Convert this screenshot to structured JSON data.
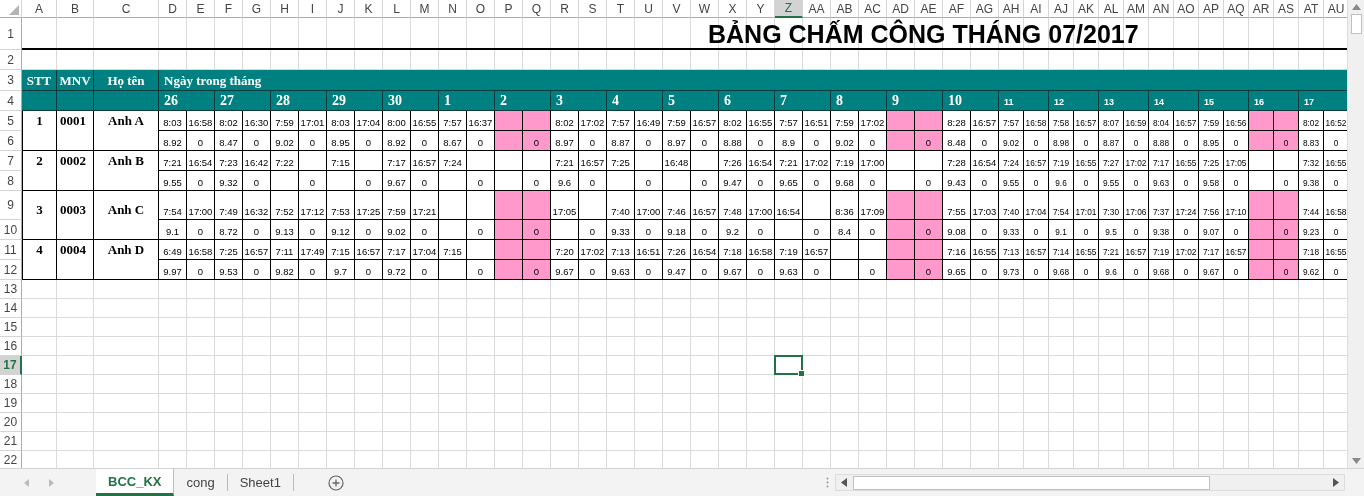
{
  "columns": [
    {
      "label": "A",
      "selected": false
    },
    {
      "label": "B",
      "selected": false
    },
    {
      "label": "C",
      "selected": false
    },
    {
      "label": "D",
      "selected": false
    },
    {
      "label": "E",
      "selected": false
    },
    {
      "label": "F",
      "selected": false
    },
    {
      "label": "G",
      "selected": false
    },
    {
      "label": "H",
      "selected": false
    },
    {
      "label": "I",
      "selected": false
    },
    {
      "label": "J",
      "selected": false
    },
    {
      "label": "K",
      "selected": false
    },
    {
      "label": "L",
      "selected": false
    },
    {
      "label": "M",
      "selected": false
    },
    {
      "label": "N",
      "selected": false
    },
    {
      "label": "O",
      "selected": false
    },
    {
      "label": "P",
      "selected": false
    },
    {
      "label": "Q",
      "selected": false
    },
    {
      "label": "R",
      "selected": false
    },
    {
      "label": "S",
      "selected": false
    },
    {
      "label": "T",
      "selected": false
    },
    {
      "label": "U",
      "selected": false
    },
    {
      "label": "V",
      "selected": false
    },
    {
      "label": "W",
      "selected": false
    },
    {
      "label": "X",
      "selected": false
    },
    {
      "label": "Y",
      "selected": false
    },
    {
      "label": "Z",
      "selected": true
    },
    {
      "label": "AA",
      "selected": false
    },
    {
      "label": "AB",
      "selected": false
    },
    {
      "label": "AC",
      "selected": false
    },
    {
      "label": "AD",
      "selected": false
    },
    {
      "label": "AE",
      "selected": false
    },
    {
      "label": "AF",
      "selected": false
    },
    {
      "label": "AG",
      "selected": false
    },
    {
      "label": "AH",
      "selected": false
    },
    {
      "label": "AI",
      "selected": false
    },
    {
      "label": "AJ",
      "selected": false
    },
    {
      "label": "AK",
      "selected": false
    },
    {
      "label": "AL",
      "selected": false
    },
    {
      "label": "AM",
      "selected": false
    },
    {
      "label": "AN",
      "selected": false
    },
    {
      "label": "AO",
      "selected": false
    },
    {
      "label": "AP",
      "selected": false
    },
    {
      "label": "AQ",
      "selected": false
    },
    {
      "label": "AR",
      "selected": false
    },
    {
      "label": "AS",
      "selected": false
    },
    {
      "label": "AT",
      "selected": false
    },
    {
      "label": "AU",
      "selected": false
    }
  ],
  "rows": [
    {
      "label": "1",
      "selected": false
    },
    {
      "label": "2",
      "selected": false
    },
    {
      "label": "3",
      "selected": false
    },
    {
      "label": "4",
      "selected": false
    },
    {
      "label": "5",
      "selected": false
    },
    {
      "label": "6",
      "selected": false
    },
    {
      "label": "7",
      "selected": false
    },
    {
      "label": "8",
      "selected": false
    },
    {
      "label": "9",
      "selected": false
    },
    {
      "label": "10",
      "selected": false
    },
    {
      "label": "11",
      "selected": false
    },
    {
      "label": "12",
      "selected": false
    },
    {
      "label": "13",
      "selected": false
    },
    {
      "label": "14",
      "selected": false
    },
    {
      "label": "15",
      "selected": false
    },
    {
      "label": "16",
      "selected": false
    },
    {
      "label": "17",
      "selected": true
    },
    {
      "label": "18",
      "selected": false
    },
    {
      "label": "19",
      "selected": false
    },
    {
      "label": "20",
      "selected": false
    },
    {
      "label": "21",
      "selected": false
    },
    {
      "label": "22",
      "selected": false
    }
  ],
  "title": "BẢNG CHẤM CÔNG THÁNG 07/2017",
  "headers": {
    "stt": "STT",
    "mnv": "MNV",
    "name": "Họ tên",
    "days": "Ngày trong tháng"
  },
  "days": [
    {
      "label": "26",
      "kind": "large"
    },
    {
      "label": "27",
      "kind": "large"
    },
    {
      "label": "28",
      "kind": "large"
    },
    {
      "label": "29",
      "kind": "large"
    },
    {
      "label": "30",
      "kind": "large"
    },
    {
      "label": "1",
      "kind": "large"
    },
    {
      "label": "2",
      "kind": "large"
    },
    {
      "label": "3",
      "kind": "large"
    },
    {
      "label": "4",
      "kind": "large"
    },
    {
      "label": "5",
      "kind": "large"
    },
    {
      "label": "6",
      "kind": "large"
    },
    {
      "label": "7",
      "kind": "large"
    },
    {
      "label": "8",
      "kind": "large"
    },
    {
      "label": "9",
      "kind": "large"
    },
    {
      "label": "10",
      "kind": "large"
    },
    {
      "label": "11",
      "kind": "small"
    },
    {
      "label": "12",
      "kind": "small"
    },
    {
      "label": "13",
      "kind": "small"
    },
    {
      "label": "14",
      "kind": "small"
    },
    {
      "label": "15",
      "kind": "small"
    },
    {
      "label": "16",
      "kind": "small"
    },
    {
      "label": "17",
      "kind": "small"
    }
  ],
  "employees": [
    {
      "stt": "1",
      "mnv": "0001",
      "name": "Anh A",
      "days": [
        {
          "in": "8:03",
          "out": "16:58",
          "hours": "8.92",
          "ot": "0",
          "off": false
        },
        {
          "in": "8:02",
          "out": "16:30",
          "hours": "8.47",
          "ot": "0",
          "off": false
        },
        {
          "in": "7:59",
          "out": "17:01",
          "hours": "9.02",
          "ot": "0",
          "off": false
        },
        {
          "in": "8:03",
          "out": "17:04",
          "hours": "8.95",
          "ot": "0",
          "off": false
        },
        {
          "in": "8:00",
          "out": "16:55",
          "hours": "8.92",
          "ot": "0",
          "off": false
        },
        {
          "in": "7:57",
          "out": "16:37",
          "hours": "8.67",
          "ot": "0",
          "off": false
        },
        {
          "ot": "0",
          "off": true
        },
        {
          "in": "8:02",
          "out": "17:02",
          "hours": "8.97",
          "ot": "0",
          "off": false
        },
        {
          "in": "7:57",
          "out": "16:49",
          "hours": "8.87",
          "ot": "0",
          "off": false
        },
        {
          "in": "7:59",
          "out": "16:57",
          "hours": "8.97",
          "ot": "0",
          "off": false
        },
        {
          "in": "8:02",
          "out": "16:55",
          "hours": "8.88",
          "ot": "0",
          "off": false
        },
        {
          "in": "7:57",
          "out": "16:51",
          "hours": "8.9",
          "ot": "0",
          "off": false
        },
        {
          "in": "7:59",
          "out": "17:02",
          "hours": "9.02",
          "ot": "0",
          "off": false
        },
        {
          "ot": "0",
          "off": true
        },
        {
          "in": "8:28",
          "out": "16:57",
          "hours": "8.48",
          "ot": "0",
          "off": false
        },
        {
          "in": "7:57",
          "out": "16:58",
          "hours": "9.02",
          "ot": "0",
          "off": false
        },
        {
          "in": "7:58",
          "out": "16:57",
          "hours": "8.98",
          "ot": "0",
          "off": false
        },
        {
          "in": "8:07",
          "out": "16:59",
          "hours": "8.87",
          "ot": "0",
          "off": false
        },
        {
          "in": "8:04",
          "out": "16:57",
          "hours": "8.88",
          "ot": "0",
          "off": false
        },
        {
          "in": "7:59",
          "out": "16:56",
          "hours": "8.95",
          "ot": "0",
          "off": false
        },
        {
          "ot": "0",
          "off": true
        },
        {
          "in": "8:02",
          "out": "16:52",
          "hours": "8.83",
          "ot": "0",
          "off": false
        }
      ]
    },
    {
      "stt": "2",
      "mnv": "0002",
      "name": "Anh B",
      "days": [
        {
          "in": "7:21",
          "out": "16:54",
          "hours": "9.55",
          "ot": "0",
          "off": false
        },
        {
          "in": "7:23",
          "out": "16:42",
          "hours": "9.32",
          "ot": "0",
          "off": false
        },
        {
          "in": "7:22",
          "ot": "0",
          "off": false
        },
        {
          "in": "7:15",
          "ot": "0",
          "off": false
        },
        {
          "in": "7:17",
          "out": "16:57",
          "hours": "9.67",
          "ot": "0",
          "off": false
        },
        {
          "in": "7:24",
          "ot": "0",
          "off": false
        },
        {
          "ot": "0",
          "off": false
        },
        {
          "in": "7:21",
          "out": "16:57",
          "hours": "9.6",
          "ot": "0",
          "off": false
        },
        {
          "in": "7:25",
          "ot": "0",
          "off": false
        },
        {
          "in": "16:48",
          "ot": "0",
          "off": false
        },
        {
          "in": "7:26",
          "out": "16:54",
          "hours": "9.47",
          "ot": "0",
          "off": false
        },
        {
          "in": "7:21",
          "out": "17:02",
          "hours": "9.65",
          "ot": "0",
          "off": false
        },
        {
          "in": "7:19",
          "out": "17:00",
          "hours": "9.68",
          "ot": "0",
          "off": false
        },
        {
          "ot": "0",
          "off": false
        },
        {
          "in": "7:28",
          "out": "16:54",
          "hours": "9.43",
          "ot": "0",
          "off": false
        },
        {
          "in": "7:24",
          "out": "16:57",
          "hours": "9.55",
          "ot": "0",
          "off": false
        },
        {
          "in": "7:19",
          "out": "16:55",
          "hours": "9.6",
          "ot": "0",
          "off": false
        },
        {
          "in": "7:27",
          "out": "17:02",
          "hours": "9.55",
          "ot": "0",
          "off": false
        },
        {
          "in": "7:17",
          "out": "16:55",
          "hours": "9.63",
          "ot": "0",
          "off": false
        },
        {
          "in": "7:25",
          "out": "17:05",
          "hours": "9.58",
          "ot": "0",
          "off": false
        },
        {
          "ot": "0",
          "off": false
        },
        {
          "in": "7:32",
          "out": "16:55",
          "hours": "9.38",
          "ot": "0",
          "off": false
        }
      ]
    },
    {
      "stt": "3",
      "mnv": "0003",
      "name": "Anh C",
      "days": [
        {
          "in": "7:54",
          "out": "17:00",
          "hours": "9.1",
          "ot": "0",
          "off": false
        },
        {
          "in": "7:49",
          "out": "16:32",
          "hours": "8.72",
          "ot": "0",
          "off": false
        },
        {
          "in": "7:52",
          "out": "17:12",
          "hours": "9.13",
          "ot": "0",
          "off": false
        },
        {
          "in": "7:53",
          "out": "17:25",
          "hours": "9.12",
          "ot": "0",
          "off": false
        },
        {
          "in": "7:59",
          "out": "17:21",
          "hours": "9.02",
          "ot": "0",
          "off": false
        },
        {
          "ot": "0",
          "off": false
        },
        {
          "ot": "0",
          "off": true
        },
        {
          "in": "17:05",
          "ot": "0",
          "off": false
        },
        {
          "in": "7:40",
          "out": "17:00",
          "hours": "9.33",
          "ot": "0",
          "off": false
        },
        {
          "in": "7:46",
          "out": "16:57",
          "hours": "9.18",
          "ot": "0",
          "off": false
        },
        {
          "in": "7:48",
          "out": "17:00",
          "hours": "9.2",
          "ot": "0",
          "off": false
        },
        {
          "in": "16:54",
          "ot": "0",
          "off": false
        },
        {
          "in": "8:36",
          "out": "17:09",
          "hours": "8.4",
          "ot": "0",
          "off": false
        },
        {
          "ot": "0",
          "off": true
        },
        {
          "in": "7:55",
          "out": "17:03",
          "hours": "9.08",
          "ot": "0",
          "off": false
        },
        {
          "in": "7:40",
          "out": "17:04",
          "hours": "9.33",
          "ot": "0",
          "off": false
        },
        {
          "in": "7:54",
          "out": "17:01",
          "hours": "9.1",
          "ot": "0",
          "off": false
        },
        {
          "in": "7:30",
          "out": "17:06",
          "hours": "9.5",
          "ot": "0",
          "off": false
        },
        {
          "in": "7:37",
          "out": "17:24",
          "hours": "9.38",
          "ot": "0",
          "off": false
        },
        {
          "in": "7:56",
          "out": "17:10",
          "hours": "9.07",
          "ot": "0",
          "off": false
        },
        {
          "ot": "0",
          "off": true
        },
        {
          "in": "7:44",
          "out": "16:58",
          "hours": "9.23",
          "ot": "0",
          "off": false
        }
      ]
    },
    {
      "stt": "4",
      "mnv": "0004",
      "name": "Anh D",
      "days": [
        {
          "in": "6:49",
          "out": "16:58",
          "hours": "9.97",
          "ot": "0",
          "off": false
        },
        {
          "in": "7:25",
          "out": "16:57",
          "hours": "9.53",
          "ot": "0",
          "off": false
        },
        {
          "in": "7:11",
          "out": "17:49",
          "hours": "9.82",
          "ot": "0",
          "off": false
        },
        {
          "in": "7:15",
          "out": "16:57",
          "hours": "9.7",
          "ot": "0",
          "off": false
        },
        {
          "in": "7:17",
          "out": "17:04",
          "hours": "9.72",
          "ot": "0",
          "off": false
        },
        {
          "in": "7:15",
          "ot": "0",
          "off": false
        },
        {
          "ot": "0",
          "off": true
        },
        {
          "in": "7:20",
          "out": "17:02",
          "hours": "9.67",
          "ot": "0",
          "off": false
        },
        {
          "in": "7:13",
          "out": "16:51",
          "hours": "9.63",
          "ot": "0",
          "off": false
        },
        {
          "in": "7:26",
          "out": "16:54",
          "hours": "9.47",
          "ot": "0",
          "off": false
        },
        {
          "in": "7:18",
          "out": "16:58",
          "hours": "9.67",
          "ot": "0",
          "off": false
        },
        {
          "in": "7:19",
          "out": "16:57",
          "hours": "9.63",
          "ot": "0",
          "off": false
        },
        {
          "ot": "0",
          "off": false
        },
        {
          "ot": "0",
          "off": true
        },
        {
          "in": "7:16",
          "out": "16:55",
          "hours": "9.65",
          "ot": "0",
          "off": false
        },
        {
          "in": "7:13",
          "out": "16:57",
          "hours": "9.73",
          "ot": "0",
          "off": false
        },
        {
          "in": "7:14",
          "out": "16:55",
          "hours": "9.68",
          "ot": "0",
          "off": false
        },
        {
          "in": "7:21",
          "out": "16:57",
          "hours": "9.6",
          "ot": "0",
          "off": false
        },
        {
          "in": "7:19",
          "out": "17:02",
          "hours": "9.68",
          "ot": "0",
          "off": false
        },
        {
          "in": "7:17",
          "out": "16:57",
          "hours": "9.67",
          "ot": "0",
          "off": false
        },
        {
          "ot": "0",
          "off": true
        },
        {
          "in": "7:18",
          "out": "16:55",
          "hours": "9.62",
          "ot": "0",
          "off": false
        }
      ]
    }
  ],
  "sheet_tabs": [
    {
      "label": "BCC_KX",
      "selected": true
    },
    {
      "label": "cong",
      "selected": false
    },
    {
      "label": "Sheet1",
      "selected": false
    }
  ]
}
